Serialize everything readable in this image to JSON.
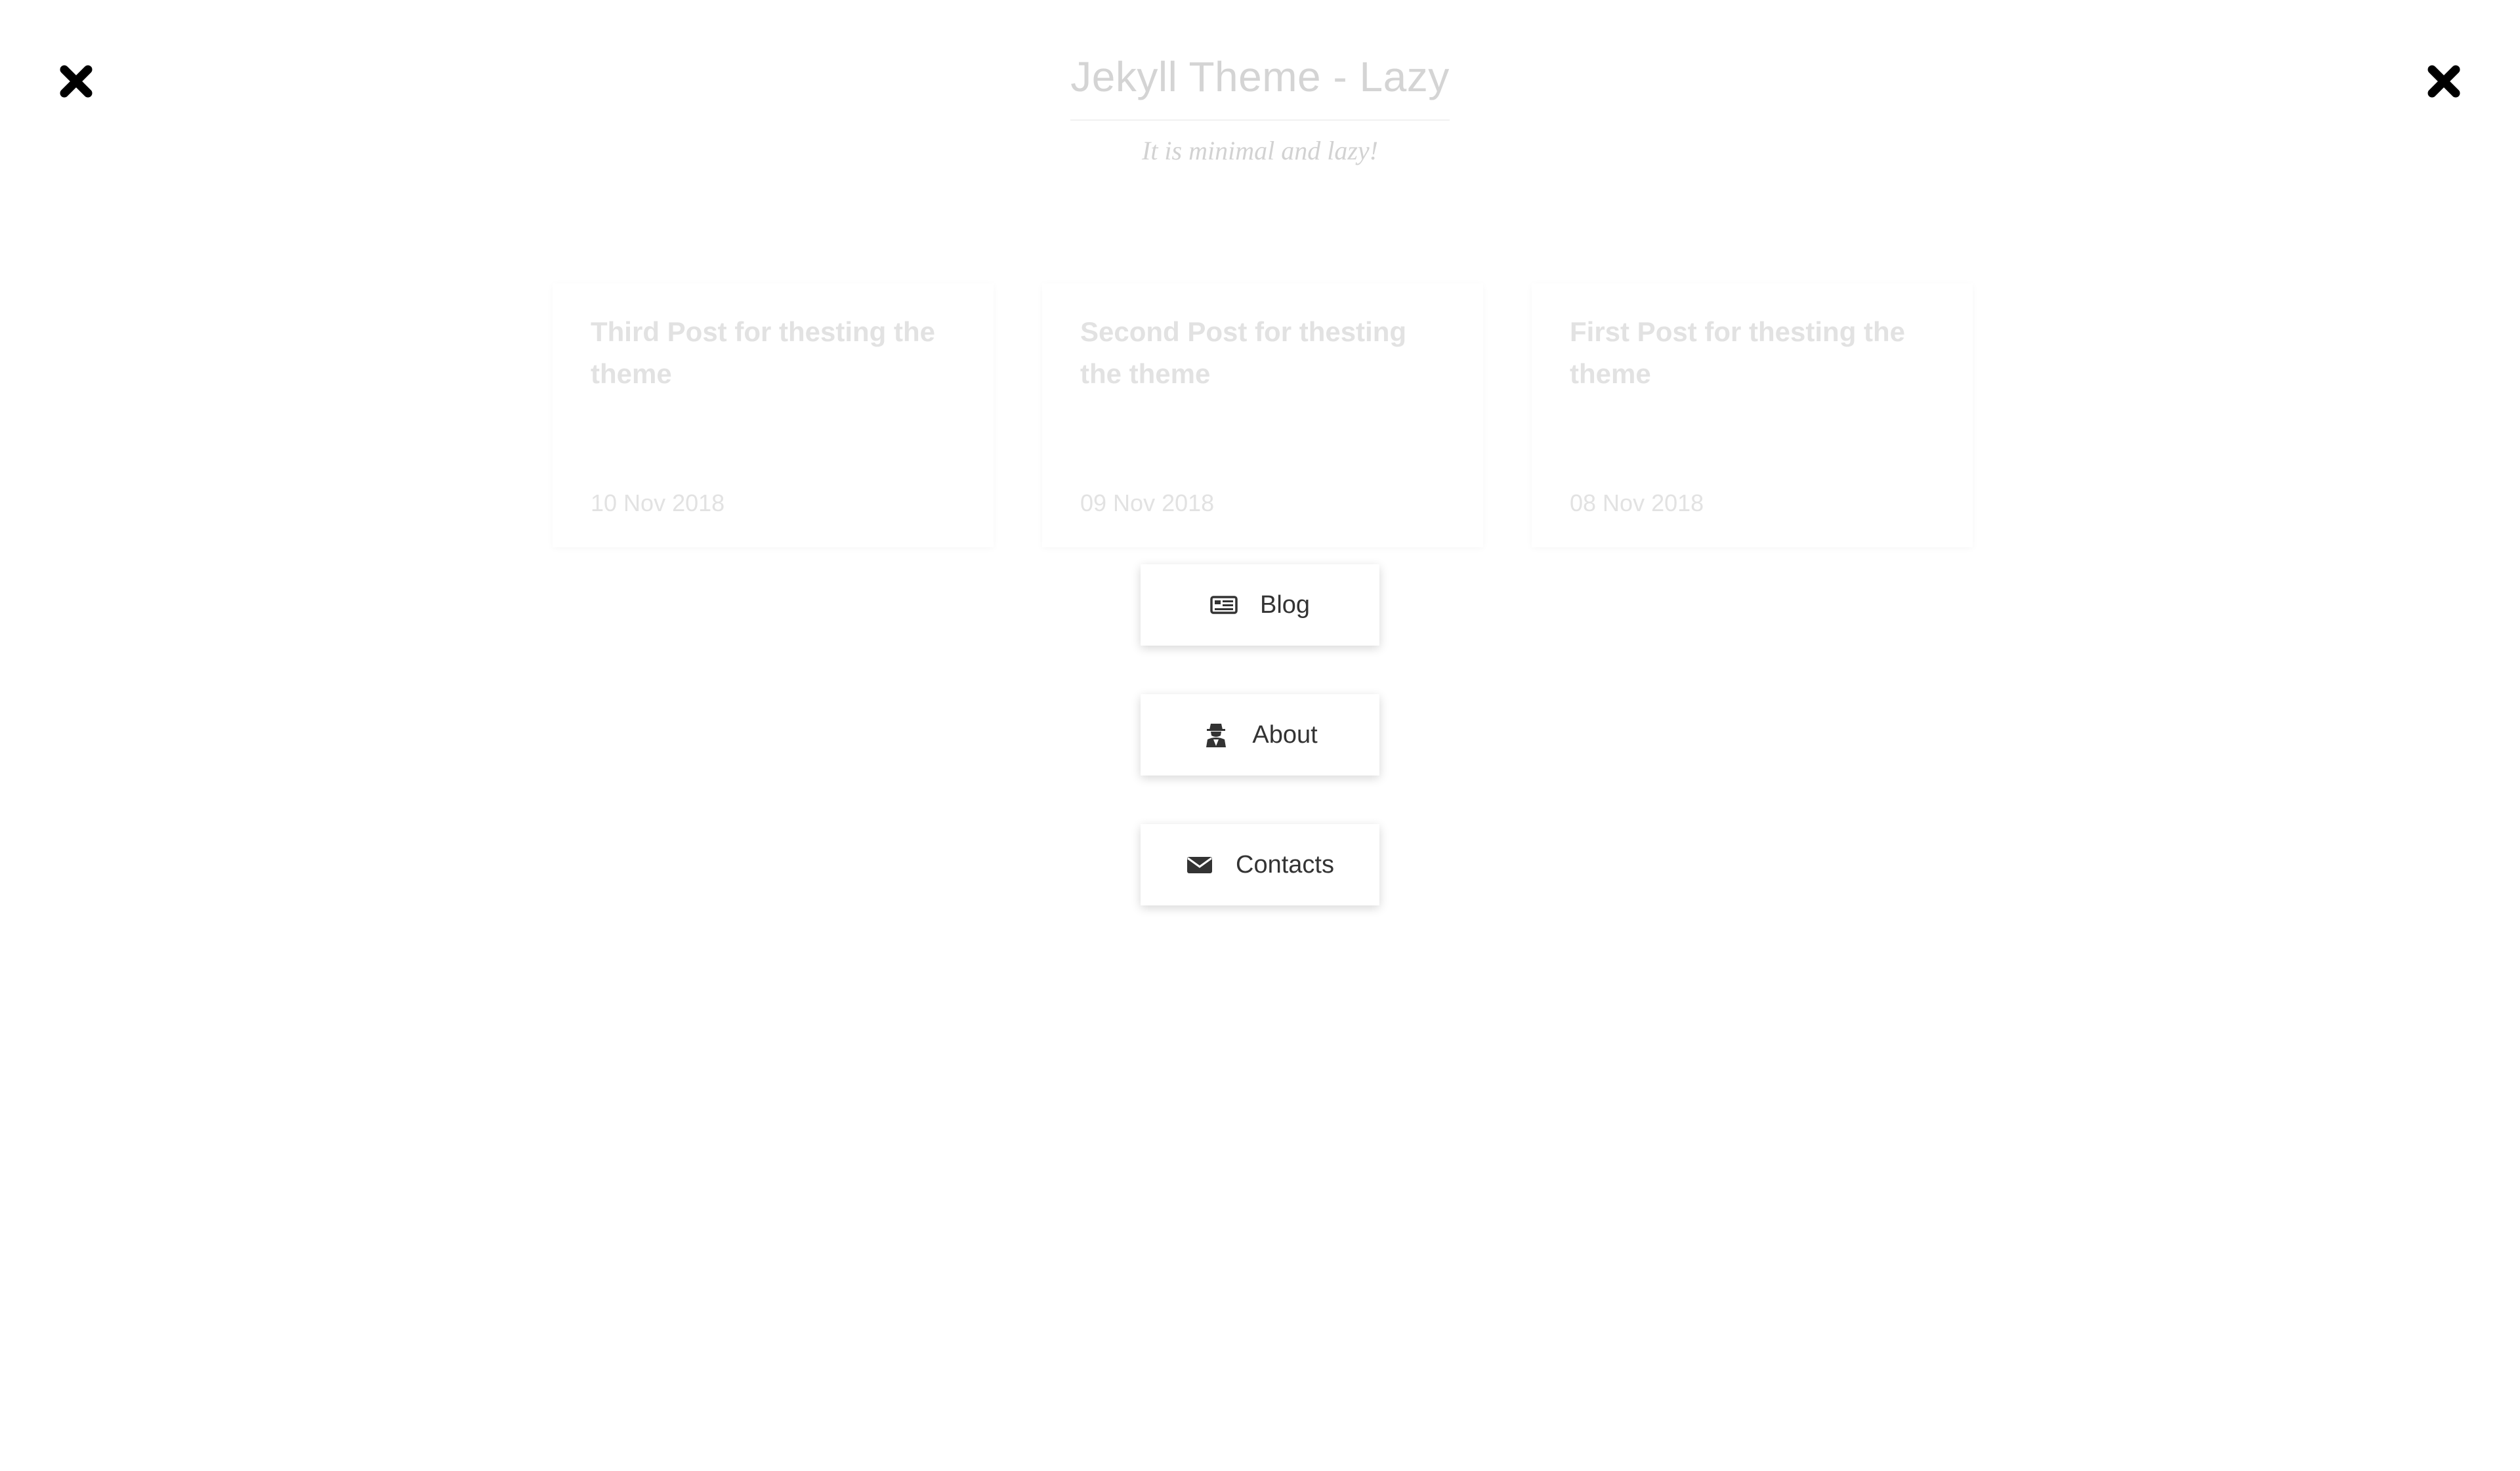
{
  "header": {
    "title": "Jekyll Theme - Lazy",
    "tagline": "It is minimal and lazy!"
  },
  "posts": [
    {
      "title": "Third Post for thesting the theme",
      "date": "10 Nov 2018"
    },
    {
      "title": "Second Post for thesting the theme",
      "date": "09 Nov 2018"
    },
    {
      "title": "First Post for thesting the theme",
      "date": "08 Nov 2018"
    }
  ],
  "menu": {
    "items": [
      {
        "label": "Blog",
        "icon": "newspaper-icon"
      },
      {
        "label": "About",
        "icon": "user-secret-icon"
      },
      {
        "label": "Contacts",
        "icon": "envelope-icon"
      }
    ]
  },
  "controls": {
    "close_left_icon": "close-icon",
    "close_right_icon": "close-icon"
  },
  "colors": {
    "background": "#ffffff",
    "title_faded": "#d4d4d4",
    "card_text_faded": "#e2e2e2",
    "menu_text": "#333333",
    "icon": "#000000"
  }
}
